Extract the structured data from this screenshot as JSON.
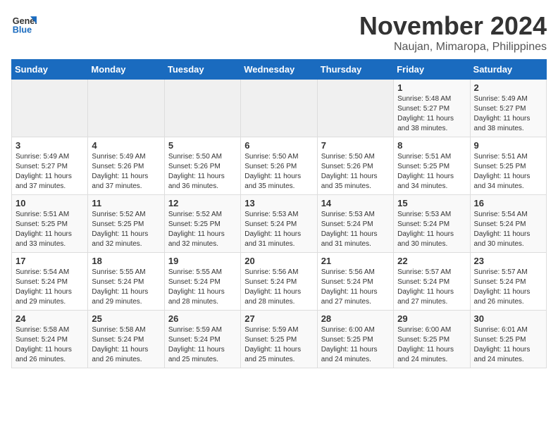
{
  "header": {
    "logo_line1": "General",
    "logo_line2": "Blue",
    "title": "November 2024",
    "subtitle": "Naujan, Mimaropa, Philippines"
  },
  "weekdays": [
    "Sunday",
    "Monday",
    "Tuesday",
    "Wednesday",
    "Thursday",
    "Friday",
    "Saturday"
  ],
  "weeks": [
    [
      {
        "day": "",
        "info": ""
      },
      {
        "day": "",
        "info": ""
      },
      {
        "day": "",
        "info": ""
      },
      {
        "day": "",
        "info": ""
      },
      {
        "day": "",
        "info": ""
      },
      {
        "day": "1",
        "info": "Sunrise: 5:48 AM\nSunset: 5:27 PM\nDaylight: 11 hours\nand 38 minutes."
      },
      {
        "day": "2",
        "info": "Sunrise: 5:49 AM\nSunset: 5:27 PM\nDaylight: 11 hours\nand 38 minutes."
      }
    ],
    [
      {
        "day": "3",
        "info": "Sunrise: 5:49 AM\nSunset: 5:27 PM\nDaylight: 11 hours\nand 37 minutes."
      },
      {
        "day": "4",
        "info": "Sunrise: 5:49 AM\nSunset: 5:26 PM\nDaylight: 11 hours\nand 37 minutes."
      },
      {
        "day": "5",
        "info": "Sunrise: 5:50 AM\nSunset: 5:26 PM\nDaylight: 11 hours\nand 36 minutes."
      },
      {
        "day": "6",
        "info": "Sunrise: 5:50 AM\nSunset: 5:26 PM\nDaylight: 11 hours\nand 35 minutes."
      },
      {
        "day": "7",
        "info": "Sunrise: 5:50 AM\nSunset: 5:26 PM\nDaylight: 11 hours\nand 35 minutes."
      },
      {
        "day": "8",
        "info": "Sunrise: 5:51 AM\nSunset: 5:25 PM\nDaylight: 11 hours\nand 34 minutes."
      },
      {
        "day": "9",
        "info": "Sunrise: 5:51 AM\nSunset: 5:25 PM\nDaylight: 11 hours\nand 34 minutes."
      }
    ],
    [
      {
        "day": "10",
        "info": "Sunrise: 5:51 AM\nSunset: 5:25 PM\nDaylight: 11 hours\nand 33 minutes."
      },
      {
        "day": "11",
        "info": "Sunrise: 5:52 AM\nSunset: 5:25 PM\nDaylight: 11 hours\nand 32 minutes."
      },
      {
        "day": "12",
        "info": "Sunrise: 5:52 AM\nSunset: 5:25 PM\nDaylight: 11 hours\nand 32 minutes."
      },
      {
        "day": "13",
        "info": "Sunrise: 5:53 AM\nSunset: 5:24 PM\nDaylight: 11 hours\nand 31 minutes."
      },
      {
        "day": "14",
        "info": "Sunrise: 5:53 AM\nSunset: 5:24 PM\nDaylight: 11 hours\nand 31 minutes."
      },
      {
        "day": "15",
        "info": "Sunrise: 5:53 AM\nSunset: 5:24 PM\nDaylight: 11 hours\nand 30 minutes."
      },
      {
        "day": "16",
        "info": "Sunrise: 5:54 AM\nSunset: 5:24 PM\nDaylight: 11 hours\nand 30 minutes."
      }
    ],
    [
      {
        "day": "17",
        "info": "Sunrise: 5:54 AM\nSunset: 5:24 PM\nDaylight: 11 hours\nand 29 minutes."
      },
      {
        "day": "18",
        "info": "Sunrise: 5:55 AM\nSunset: 5:24 PM\nDaylight: 11 hours\nand 29 minutes."
      },
      {
        "day": "19",
        "info": "Sunrise: 5:55 AM\nSunset: 5:24 PM\nDaylight: 11 hours\nand 28 minutes."
      },
      {
        "day": "20",
        "info": "Sunrise: 5:56 AM\nSunset: 5:24 PM\nDaylight: 11 hours\nand 28 minutes."
      },
      {
        "day": "21",
        "info": "Sunrise: 5:56 AM\nSunset: 5:24 PM\nDaylight: 11 hours\nand 27 minutes."
      },
      {
        "day": "22",
        "info": "Sunrise: 5:57 AM\nSunset: 5:24 PM\nDaylight: 11 hours\nand 27 minutes."
      },
      {
        "day": "23",
        "info": "Sunrise: 5:57 AM\nSunset: 5:24 PM\nDaylight: 11 hours\nand 26 minutes."
      }
    ],
    [
      {
        "day": "24",
        "info": "Sunrise: 5:58 AM\nSunset: 5:24 PM\nDaylight: 11 hours\nand 26 minutes."
      },
      {
        "day": "25",
        "info": "Sunrise: 5:58 AM\nSunset: 5:24 PM\nDaylight: 11 hours\nand 26 minutes."
      },
      {
        "day": "26",
        "info": "Sunrise: 5:59 AM\nSunset: 5:24 PM\nDaylight: 11 hours\nand 25 minutes."
      },
      {
        "day": "27",
        "info": "Sunrise: 5:59 AM\nSunset: 5:25 PM\nDaylight: 11 hours\nand 25 minutes."
      },
      {
        "day": "28",
        "info": "Sunrise: 6:00 AM\nSunset: 5:25 PM\nDaylight: 11 hours\nand 24 minutes."
      },
      {
        "day": "29",
        "info": "Sunrise: 6:00 AM\nSunset: 5:25 PM\nDaylight: 11 hours\nand 24 minutes."
      },
      {
        "day": "30",
        "info": "Sunrise: 6:01 AM\nSunset: 5:25 PM\nDaylight: 11 hours\nand 24 minutes."
      }
    ]
  ]
}
